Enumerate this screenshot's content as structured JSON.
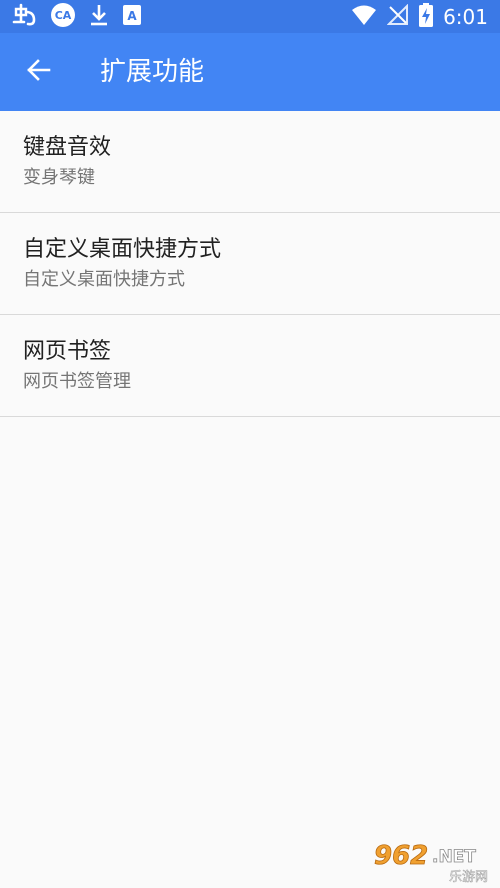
{
  "status_bar": {
    "time": "6:01",
    "left_icons": [
      "app-logo-icon",
      "cloud-app-icon",
      "download-icon",
      "accessibility-icon"
    ],
    "right_icons": [
      "wifi-icon",
      "no-signal-icon",
      "battery-charging-icon"
    ]
  },
  "app_bar": {
    "title": "扩展功能",
    "back_icon": "arrow-back-icon",
    "color": "#4285f4"
  },
  "items": [
    {
      "title": "键盘音效",
      "subtitle": "变身琴键"
    },
    {
      "title": "自定义桌面快捷方式",
      "subtitle": "自定义桌面快捷方式"
    },
    {
      "title": "网页书签",
      "subtitle": "网页书签管理"
    }
  ],
  "watermark": {
    "logo_text": "962",
    "suffix": ".NET",
    "caption": "乐游网"
  }
}
